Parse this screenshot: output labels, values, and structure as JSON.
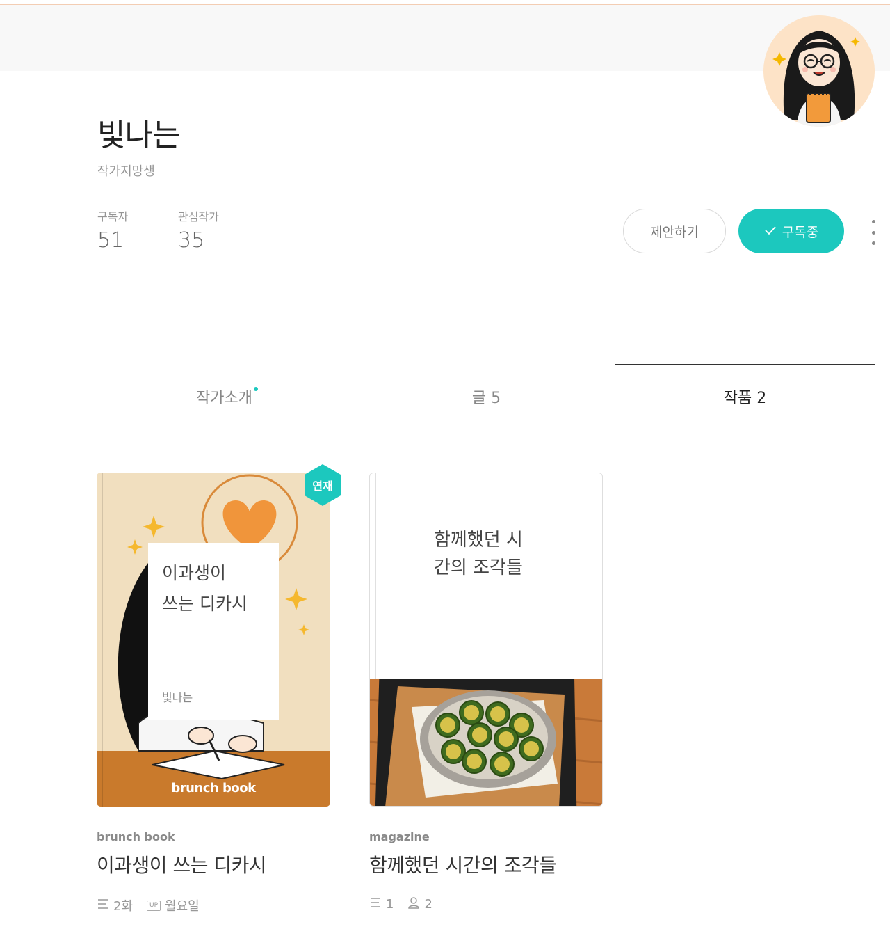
{
  "profile": {
    "name": "빛나는",
    "job": "작가지망생",
    "stats": [
      {
        "label": "구독자",
        "value": "51"
      },
      {
        "label": "관심작가",
        "value": "35"
      }
    ],
    "buttons": {
      "propose": "제안하기",
      "subscribe": "구독중"
    }
  },
  "tabs": [
    {
      "label": "작가소개",
      "active": false,
      "new_dot": true
    },
    {
      "label": "글 5",
      "active": false
    },
    {
      "label": "작품 2",
      "active": true
    }
  ],
  "works": [
    {
      "type": "brunch book",
      "title": "이과생이 쓰는 디카시",
      "cover_title_line1": "이과생이",
      "cover_title_line2": "쓰는 디카시",
      "cover_author": "빛나는",
      "cover_logo": "brunch book",
      "badge": "연재",
      "episodes": "2화",
      "up_label": "UP",
      "schedule": "월요일"
    },
    {
      "type": "magazine",
      "title": "함께했던 시간의 조각들",
      "cover_title_line1": "함께했던 시",
      "cover_title_line2": "간의 조각들",
      "posts": "1",
      "members": "2"
    }
  ],
  "colors": {
    "accent": "#1cc8be",
    "topband": "#f8f8f8"
  }
}
